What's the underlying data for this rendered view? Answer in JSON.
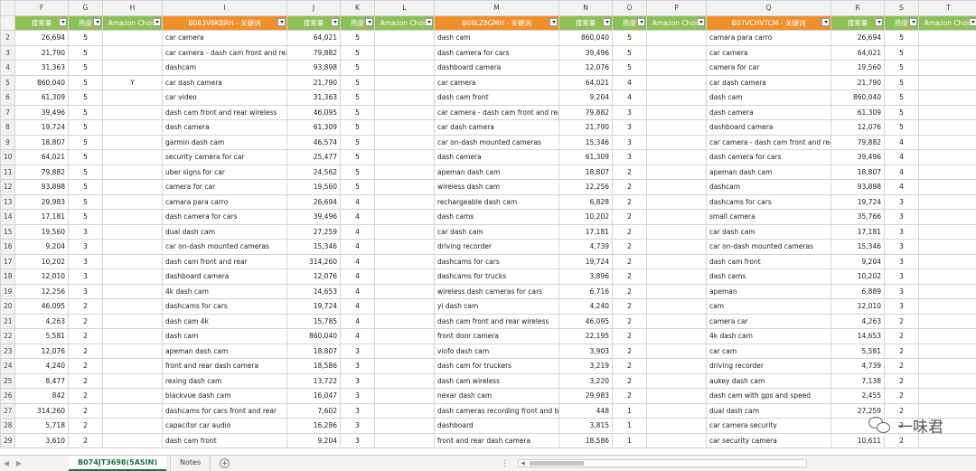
{
  "columns": [
    "F",
    "G",
    "H",
    "I",
    "J",
    "K",
    "L",
    "M",
    "N",
    "O",
    "P",
    "Q",
    "R",
    "S",
    "T"
  ],
  "headers": [
    {
      "text": "搜索量",
      "color": "green"
    },
    {
      "text": "热度",
      "color": "green"
    },
    {
      "text": "Amazon Choic",
      "color": "green"
    },
    {
      "text": "B083V6KBRH - 关键词",
      "color": "orange"
    },
    {
      "text": "搜索量",
      "color": "green"
    },
    {
      "text": "热度",
      "color": "green"
    },
    {
      "text": "Amazon Choic",
      "color": "green"
    },
    {
      "text": "B08LZ8GMH - 关键词",
      "color": "orange"
    },
    {
      "text": "搜索量",
      "color": "green"
    },
    {
      "text": "热度",
      "color": "green"
    },
    {
      "text": "Amazon Choic",
      "color": "green"
    },
    {
      "text": "B07VCHVTCM - 关键词",
      "color": "orange"
    },
    {
      "text": "搜索量",
      "color": "green"
    },
    {
      "text": "热度",
      "color": "green"
    },
    {
      "text": "Amazon Choic",
      "color": "green"
    }
  ],
  "header_colors": {
    "green": "#8dc055",
    "orange": "#f0902c"
  },
  "rows": [
    {
      "n": "2",
      "c": [
        "26,694",
        "5",
        "",
        "car camera",
        "64,021",
        "5",
        "",
        "dash cam",
        "860,040",
        "5",
        "",
        "camara para carro",
        "26,694",
        "5",
        ""
      ]
    },
    {
      "n": "3",
      "c": [
        "21,790",
        "5",
        "",
        "car camera - dash cam front and rear",
        "79,882",
        "5",
        "",
        "dash camera for cars",
        "39,496",
        "5",
        "",
        "car camera",
        "64,021",
        "5",
        ""
      ]
    },
    {
      "n": "4",
      "c": [
        "31,363",
        "5",
        "",
        "dashcam",
        "93,898",
        "5",
        "",
        "dashboard camera",
        "12,076",
        "5",
        "",
        "camera for car",
        "19,560",
        "5",
        ""
      ]
    },
    {
      "n": "5",
      "c": [
        "860,040",
        "5",
        "Y",
        "car dash camera",
        "21,790",
        "5",
        "",
        "car camera",
        "64,021",
        "4",
        "",
        "car dash camera",
        "21,790",
        "5",
        ""
      ]
    },
    {
      "n": "6",
      "c": [
        "61,309",
        "5",
        "",
        "car video",
        "31,363",
        "5",
        "",
        "dash cam front",
        "9,204",
        "4",
        "",
        "dash cam",
        "860,040",
        "5",
        ""
      ]
    },
    {
      "n": "7",
      "c": [
        "39,496",
        "5",
        "",
        "dash cam front and rear wireless",
        "46,095",
        "5",
        "",
        "car camera - dash cam front and rear",
        "79,882",
        "3",
        "",
        "dash camera",
        "61,309",
        "5",
        ""
      ]
    },
    {
      "n": "8",
      "c": [
        "19,724",
        "5",
        "",
        "dash camera",
        "61,309",
        "5",
        "",
        "car dash camera",
        "21,790",
        "3",
        "",
        "dashboard camera",
        "12,076",
        "5",
        ""
      ]
    },
    {
      "n": "9",
      "c": [
        "18,807",
        "5",
        "",
        "garmin dash cam",
        "46,574",
        "5",
        "",
        "car on-dash mounted cameras",
        "15,346",
        "3",
        "",
        "car camera - dash cam front and rear",
        "79,882",
        "4",
        ""
      ]
    },
    {
      "n": "10",
      "c": [
        "64,021",
        "5",
        "",
        "security camera for car",
        "25,477",
        "5",
        "",
        "dash camera",
        "61,309",
        "3",
        "",
        "dash camera for cars",
        "39,496",
        "4",
        ""
      ]
    },
    {
      "n": "11",
      "c": [
        "79,882",
        "5",
        "",
        "uber signs for car",
        "24,562",
        "5",
        "",
        "apeman dash cam",
        "18,807",
        "2",
        "",
        "apeman dash cam",
        "18,807",
        "4",
        ""
      ]
    },
    {
      "n": "12",
      "c": [
        "93,898",
        "5",
        "",
        "camera for car",
        "19,560",
        "5",
        "",
        "wireless dash cam",
        "12,256",
        "2",
        "",
        "dashcam",
        "93,898",
        "4",
        ""
      ]
    },
    {
      "n": "13",
      "c": [
        "29,983",
        "5",
        "",
        "camara para carro",
        "26,694",
        "4",
        "",
        "rechargeable dash cam",
        "6,828",
        "2",
        "",
        "dashcams for cars",
        "19,724",
        "3",
        ""
      ]
    },
    {
      "n": "14",
      "c": [
        "17,181",
        "5",
        "",
        "dash camera for cars",
        "39,496",
        "4",
        "",
        "dash cams",
        "10,202",
        "2",
        "",
        "small camera",
        "35,766",
        "3",
        ""
      ]
    },
    {
      "n": "15",
      "c": [
        "19,560",
        "3",
        "",
        "dual dash cam",
        "27,259",
        "4",
        "",
        "car dash cam",
        "17,181",
        "2",
        "",
        "car dash cam",
        "17,181",
        "3",
        ""
      ]
    },
    {
      "n": "16",
      "c": [
        "9,204",
        "3",
        "",
        "car on-dash mounted cameras",
        "15,346",
        "4",
        "",
        "driving recorder",
        "4,739",
        "2",
        "",
        "car on-dash mounted cameras",
        "15,346",
        "3",
        ""
      ]
    },
    {
      "n": "17",
      "c": [
        "10,202",
        "3",
        "",
        "dash cam front and rear",
        "314,260",
        "4",
        "",
        "dashcams for cars",
        "19,724",
        "2",
        "",
        "dash cam front",
        "9,204",
        "3",
        ""
      ]
    },
    {
      "n": "18",
      "c": [
        "12,010",
        "3",
        "",
        "dashboard camera",
        "12,076",
        "4",
        "",
        "dashcams for trucks",
        "3,896",
        "2",
        "",
        "dash cams",
        "10,202",
        "3",
        ""
      ]
    },
    {
      "n": "19",
      "c": [
        "12,256",
        "3",
        "",
        "4k dash cam",
        "14,653",
        "4",
        "",
        "wireless dash cameras for cars",
        "6,716",
        "2",
        "",
        "apeman",
        "6,889",
        "3",
        ""
      ]
    },
    {
      "n": "20",
      "c": [
        "46,095",
        "2",
        "",
        "dashcams for cars",
        "19,724",
        "4",
        "",
        "yi dash cam",
        "4,240",
        "2",
        "",
        "cam",
        "12,010",
        "3",
        ""
      ]
    },
    {
      "n": "21",
      "c": [
        "4,263",
        "2",
        "",
        "dash cam 4k",
        "15,785",
        "4",
        "",
        "dash cam front and rear wireless",
        "46,095",
        "2",
        "",
        "camera car",
        "4,263",
        "2",
        ""
      ]
    },
    {
      "n": "22",
      "c": [
        "5,581",
        "2",
        "",
        "dash cam",
        "860,040",
        "4",
        "",
        "front door camera",
        "22,195",
        "2",
        "",
        "4k dash cam",
        "14,653",
        "2",
        ""
      ]
    },
    {
      "n": "23",
      "c": [
        "12,076",
        "2",
        "",
        "apeman dash cam",
        "18,807",
        "3",
        "",
        "viofo dash cam",
        "3,903",
        "2",
        "",
        "car cam",
        "5,581",
        "2",
        ""
      ]
    },
    {
      "n": "24",
      "c": [
        "4,240",
        "2",
        "",
        "front and rear dash camera",
        "18,586",
        "3",
        "",
        "dash cam for truckers",
        "3,219",
        "2",
        "",
        "driving recorder",
        "4,739",
        "2",
        ""
      ]
    },
    {
      "n": "25",
      "c": [
        "8,477",
        "2",
        "",
        "rexing dash cam",
        "13,722",
        "3",
        "",
        "dash cam wireless",
        "3,220",
        "2",
        "",
        "aukey dash cam",
        "7,138",
        "2",
        ""
      ]
    },
    {
      "n": "26",
      "c": [
        "842",
        "2",
        "",
        "blackvue dash cam",
        "16,047",
        "3",
        "",
        "nexar dash cam",
        "29,983",
        "2",
        "",
        "dash cam with gps and speed",
        "2,455",
        "2",
        ""
      ]
    },
    {
      "n": "27",
      "c": [
        "314,260",
        "2",
        "",
        "dashcams for cars front and rear",
        "7,602",
        "3",
        "",
        "dash cameras recording front and back",
        "448",
        "1",
        "",
        "dual dash cam",
        "27,259",
        "2",
        ""
      ]
    },
    {
      "n": "28",
      "c": [
        "5,718",
        "2",
        "",
        "capacitor car audio",
        "16,286",
        "3",
        "",
        "dashboard",
        "3,815",
        "1",
        "",
        "car camera security",
        "",
        "2",
        ""
      ]
    },
    {
      "n": "29",
      "c": [
        "3,610",
        "2",
        "",
        "dash cam front",
        "9,204",
        "3",
        "",
        "front and rear dash camera",
        "18,586",
        "1",
        "",
        "car security camera",
        "10,611",
        "2",
        ""
      ]
    }
  ],
  "sheet_tabs": {
    "active": "B074JT3698(5ASIN)",
    "other": "Notes",
    "add": "+"
  },
  "statusbar": {
    "ellipsis": "⋮",
    "left_arrow": "◀",
    "right_arrow": "▶",
    "scroll_left": "◀",
    "scroll_right": "▶"
  },
  "watermark": {
    "text": "一味君",
    "icon": "wechat-icon"
  }
}
